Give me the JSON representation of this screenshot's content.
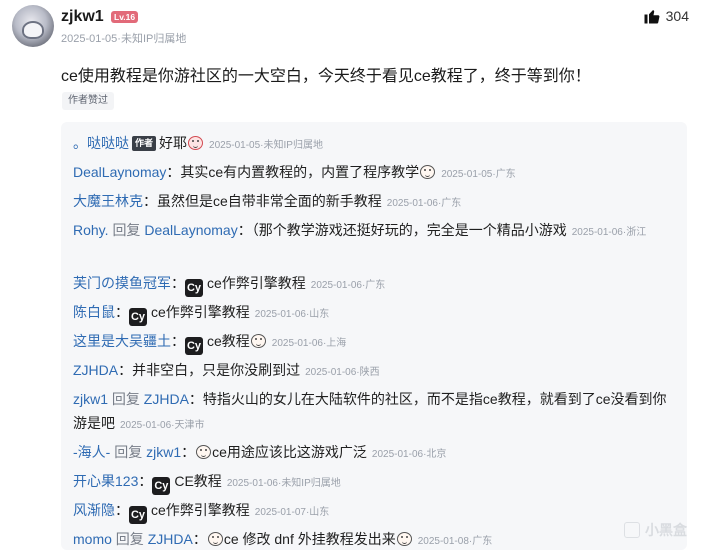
{
  "post": {
    "username": "zjkw1",
    "level": "Lv.16",
    "date": "2025-01-05",
    "location": "未知IP归属地",
    "likes": "304",
    "content": "ce使用教程是你游社区的一大空白，今天终于看见ce教程了，终于等到你！",
    "author_liked": "作者赞过"
  },
  "replies": [
    {
      "name": "。哒哒哒",
      "author_badge": "作者",
      "reply_to": "",
      "text": "好耶",
      "emoji_after": true,
      "cy": false,
      "date": "2025-01-05",
      "location": "未知IP归属地"
    },
    {
      "name": "DealLaynomay",
      "reply_to": "",
      "text": "其实ce有内置教程的，内置了程序教学",
      "emoji_after": true,
      "cy": false,
      "date": "2025-01-05",
      "location": "广东"
    },
    {
      "name": "大魔王林克",
      "reply_to": "",
      "text": "虽然但是ce自带非常全面的新手教程",
      "cy": false,
      "date": "2025-01-06",
      "location": "广东"
    },
    {
      "name": "Rohy.",
      "reply_label": "回复",
      "reply_to": "DealLaynomay",
      "text": "（那个教学游戏还挺好玩的，完全是一个精品小游戏",
      "cy": false,
      "date": "2025-01-06",
      "location": "浙江"
    },
    {
      "name": "芙门の摸鱼冠军",
      "reply_to": "",
      "text": "ce作弊引擎教程",
      "cy": true,
      "date": "2025-01-06",
      "location": "广东"
    },
    {
      "name": "陈白鼠",
      "reply_to": "",
      "text": "ce作弊引擎教程",
      "cy": true,
      "date": "2025-01-06",
      "location": "山东"
    },
    {
      "name": "这里是大吴疆土",
      "reply_to": "",
      "text": "ce教程",
      "emoji_after": true,
      "cy": true,
      "date": "2025-01-06",
      "location": "上海"
    },
    {
      "name": "ZJHDA",
      "reply_to": "",
      "text": "并非空白，只是你没刷到过",
      "cy": false,
      "date": "2025-01-06",
      "location": "陕西"
    },
    {
      "name": "zjkw1",
      "reply_label": "回复",
      "reply_to": "ZJHDA",
      "text": "特指火山的女儿在大陆软件的社区，而不是指ce教程，就看到了ce没看到你游是吧",
      "cy": false,
      "date": "2025-01-06",
      "location": "天津市"
    },
    {
      "name": "-海人-",
      "reply_label": "回复",
      "reply_to": "zjkw1",
      "text": "ce用途应该比这游戏广泛",
      "emoji_before": true,
      "cy": false,
      "date": "2025-01-06",
      "location": "北京"
    },
    {
      "name": "开心果123",
      "reply_to": "",
      "text": "CE教程",
      "cy": true,
      "date": "2025-01-06",
      "location": "未知IP归属地"
    },
    {
      "name": "风渐隐",
      "reply_to": "",
      "text": "ce作弊引擎教程",
      "cy": true,
      "date": "2025-01-07",
      "location": "山东"
    },
    {
      "name": "momo",
      "reply_label": "回复",
      "reply_to": "ZJHDA",
      "text": "ce 修改 dnf 外挂教程发出来",
      "emoji_before": true,
      "emoji_after": true,
      "cy": false,
      "date": "2025-01-08",
      "location": "广东"
    }
  ],
  "cy_label": "Cy",
  "separator": "：",
  "meta_dot": "·",
  "watermark": "小黑盒",
  "icons": {
    "like": "thumbs-up-icon",
    "cheat_engine": "cheat-engine-icon",
    "emoji": "emoji-icon",
    "watermark": "heybox-logo-icon"
  }
}
